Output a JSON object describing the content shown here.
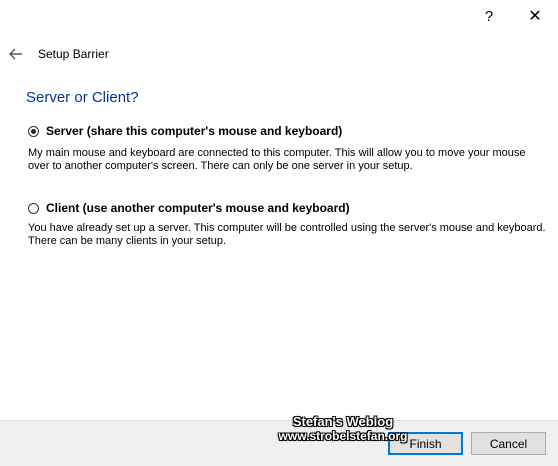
{
  "titlebar": {
    "help_glyph": "?",
    "close_glyph": "✕"
  },
  "header": {
    "title": "Setup Barrier"
  },
  "page": {
    "title": "Server or Client?"
  },
  "options": {
    "server": {
      "label": "Server (share this computer's mouse and keyboard)",
      "description": "My main mouse and keyboard are connected to this computer. This will allow you to move your mouse over to another computer's screen. There can only be one server in your setup.",
      "selected": true
    },
    "client": {
      "label": "Client (use another computer's mouse and keyboard)",
      "description": "You have already set up a server. This computer will be controlled using the server's mouse and keyboard. There can be many clients in your setup.",
      "selected": false
    }
  },
  "footer": {
    "finish_label": "Finish",
    "cancel_label": "Cancel"
  },
  "watermark": {
    "line1": "Stefan's Weblog",
    "line2": "www.strobelstefan.org"
  },
  "colors": {
    "title_blue": "#003399",
    "accent": "#0078d7",
    "footer_bg": "#f0f0f0"
  }
}
